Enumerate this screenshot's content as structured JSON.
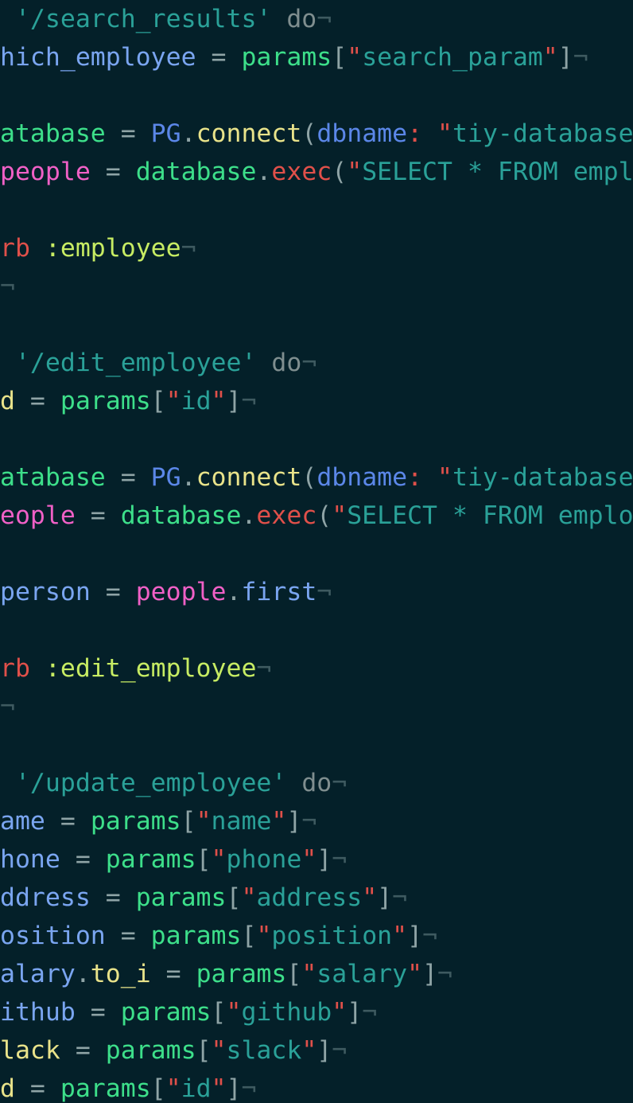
{
  "editor": {
    "background": "#042029",
    "lines": [
      [
        [
          "t-plain",
          " "
        ],
        [
          "t-str",
          "'/search_results'"
        ],
        [
          "t-plain",
          " "
        ],
        [
          "t-kw",
          "do"
        ],
        [
          "t-nl",
          "¬"
        ]
      ],
      [
        [
          "t-ivar",
          "hich_employee"
        ],
        [
          "t-op",
          " = "
        ],
        [
          "t-green",
          "params"
        ],
        [
          "t-punc",
          "["
        ],
        [
          "t-red",
          "\""
        ],
        [
          "t-str",
          "search_param"
        ],
        [
          "t-red",
          "\""
        ],
        [
          "t-punc",
          "]"
        ],
        [
          "t-nl",
          "¬"
        ]
      ],
      [],
      [
        [
          "t-green",
          "atabase"
        ],
        [
          "t-op",
          " = "
        ],
        [
          "t-blue",
          "PG"
        ],
        [
          "t-punc",
          "."
        ],
        [
          "t-yellow",
          "connect"
        ],
        [
          "t-punc",
          "("
        ],
        [
          "t-blue",
          "dbname"
        ],
        [
          "t-red",
          ":"
        ],
        [
          "t-plain",
          " "
        ],
        [
          "t-red",
          "\""
        ],
        [
          "t-str",
          "tiy-database"
        ]
      ],
      [
        [
          "t-magenta",
          "people"
        ],
        [
          "t-op",
          " = "
        ],
        [
          "t-green",
          "database"
        ],
        [
          "t-punc",
          "."
        ],
        [
          "t-red",
          "exec"
        ],
        [
          "t-punc",
          "("
        ],
        [
          "t-red",
          "\""
        ],
        [
          "t-str",
          "SELECT * FROM empl"
        ]
      ],
      [],
      [
        [
          "t-red",
          "rb"
        ],
        [
          "t-plain",
          " "
        ],
        [
          "t-sym",
          ":employee"
        ],
        [
          "t-nl",
          "¬"
        ]
      ],
      [
        [
          "t-nl",
          "¬"
        ]
      ],
      [],
      [
        [
          "t-plain",
          " "
        ],
        [
          "t-str",
          "'/edit_employee'"
        ],
        [
          "t-plain",
          " "
        ],
        [
          "t-kw",
          "do"
        ],
        [
          "t-nl",
          "¬"
        ]
      ],
      [
        [
          "t-yellow",
          "d"
        ],
        [
          "t-op",
          " = "
        ],
        [
          "t-green",
          "params"
        ],
        [
          "t-punc",
          "["
        ],
        [
          "t-red",
          "\""
        ],
        [
          "t-str",
          "id"
        ],
        [
          "t-red",
          "\""
        ],
        [
          "t-punc",
          "]"
        ],
        [
          "t-nl",
          "¬"
        ]
      ],
      [],
      [
        [
          "t-green",
          "atabase"
        ],
        [
          "t-op",
          " = "
        ],
        [
          "t-blue",
          "PG"
        ],
        [
          "t-punc",
          "."
        ],
        [
          "t-yellow",
          "connect"
        ],
        [
          "t-punc",
          "("
        ],
        [
          "t-blue",
          "dbname"
        ],
        [
          "t-red",
          ":"
        ],
        [
          "t-plain",
          " "
        ],
        [
          "t-red",
          "\""
        ],
        [
          "t-str",
          "tiy-database"
        ]
      ],
      [
        [
          "t-magenta",
          "eople"
        ],
        [
          "t-op",
          " = "
        ],
        [
          "t-green",
          "database"
        ],
        [
          "t-punc",
          "."
        ],
        [
          "t-red",
          "exec"
        ],
        [
          "t-punc",
          "("
        ],
        [
          "t-red",
          "\""
        ],
        [
          "t-str",
          "SELECT * FROM emplo"
        ]
      ],
      [],
      [
        [
          "t-ivar",
          "person"
        ],
        [
          "t-op",
          " = "
        ],
        [
          "t-magenta",
          "people"
        ],
        [
          "t-punc",
          "."
        ],
        [
          "t-ivar",
          "first"
        ],
        [
          "t-nl",
          "¬"
        ]
      ],
      [],
      [
        [
          "t-red",
          "rb"
        ],
        [
          "t-plain",
          " "
        ],
        [
          "t-sym",
          ":edit_employee"
        ],
        [
          "t-nl",
          "¬"
        ]
      ],
      [
        [
          "t-nl",
          "¬"
        ]
      ],
      [],
      [
        [
          "t-plain",
          " "
        ],
        [
          "t-str",
          "'/update_employee'"
        ],
        [
          "t-plain",
          " "
        ],
        [
          "t-kw",
          "do"
        ],
        [
          "t-nl",
          "¬"
        ]
      ],
      [
        [
          "t-ivar",
          "ame"
        ],
        [
          "t-op",
          " = "
        ],
        [
          "t-green",
          "params"
        ],
        [
          "t-punc",
          "["
        ],
        [
          "t-red",
          "\""
        ],
        [
          "t-str",
          "name"
        ],
        [
          "t-red",
          "\""
        ],
        [
          "t-punc",
          "]"
        ],
        [
          "t-nl",
          "¬"
        ]
      ],
      [
        [
          "t-ivar",
          "hone"
        ],
        [
          "t-op",
          " = "
        ],
        [
          "t-green",
          "params"
        ],
        [
          "t-punc",
          "["
        ],
        [
          "t-red",
          "\""
        ],
        [
          "t-str",
          "phone"
        ],
        [
          "t-red",
          "\""
        ],
        [
          "t-punc",
          "]"
        ],
        [
          "t-nl",
          "¬"
        ]
      ],
      [
        [
          "t-ivar",
          "ddress"
        ],
        [
          "t-op",
          " = "
        ],
        [
          "t-green",
          "params"
        ],
        [
          "t-punc",
          "["
        ],
        [
          "t-red",
          "\""
        ],
        [
          "t-str",
          "address"
        ],
        [
          "t-red",
          "\""
        ],
        [
          "t-punc",
          "]"
        ],
        [
          "t-nl",
          "¬"
        ]
      ],
      [
        [
          "t-ivar",
          "osition"
        ],
        [
          "t-op",
          " = "
        ],
        [
          "t-green",
          "params"
        ],
        [
          "t-punc",
          "["
        ],
        [
          "t-red",
          "\""
        ],
        [
          "t-str",
          "position"
        ],
        [
          "t-red",
          "\""
        ],
        [
          "t-punc",
          "]"
        ],
        [
          "t-nl",
          "¬"
        ]
      ],
      [
        [
          "t-ivar",
          "alary"
        ],
        [
          "t-punc",
          "."
        ],
        [
          "t-yellow",
          "to_i"
        ],
        [
          "t-op",
          " = "
        ],
        [
          "t-green",
          "params"
        ],
        [
          "t-punc",
          "["
        ],
        [
          "t-red",
          "\""
        ],
        [
          "t-str",
          "salary"
        ],
        [
          "t-red",
          "\""
        ],
        [
          "t-punc",
          "]"
        ],
        [
          "t-nl",
          "¬"
        ]
      ],
      [
        [
          "t-ivar",
          "ithub"
        ],
        [
          "t-op",
          " = "
        ],
        [
          "t-green",
          "params"
        ],
        [
          "t-punc",
          "["
        ],
        [
          "t-red",
          "\""
        ],
        [
          "t-str",
          "github"
        ],
        [
          "t-red",
          "\""
        ],
        [
          "t-punc",
          "]"
        ],
        [
          "t-nl",
          "¬"
        ]
      ],
      [
        [
          "t-yellow",
          "lack"
        ],
        [
          "t-op",
          " = "
        ],
        [
          "t-green",
          "params"
        ],
        [
          "t-punc",
          "["
        ],
        [
          "t-red",
          "\""
        ],
        [
          "t-str",
          "slack"
        ],
        [
          "t-red",
          "\""
        ],
        [
          "t-punc",
          "]"
        ],
        [
          "t-nl",
          "¬"
        ]
      ],
      [
        [
          "t-yellow",
          "d"
        ],
        [
          "t-op",
          " = "
        ],
        [
          "t-green",
          "params"
        ],
        [
          "t-punc",
          "["
        ],
        [
          "t-red",
          "\""
        ],
        [
          "t-str",
          "id"
        ],
        [
          "t-red",
          "\""
        ],
        [
          "t-punc",
          "]"
        ],
        [
          "t-nl",
          "¬"
        ]
      ]
    ]
  }
}
